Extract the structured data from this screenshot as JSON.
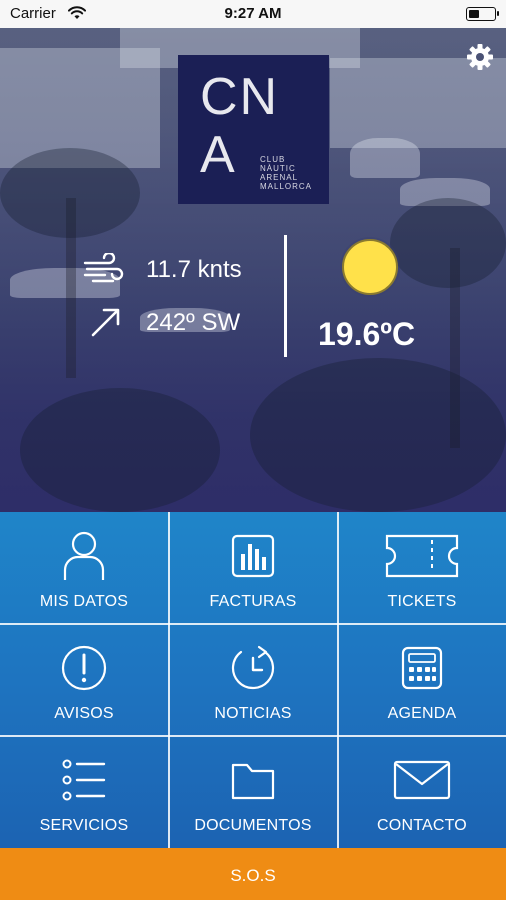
{
  "status_bar": {
    "carrier": "Carrier",
    "time": "9:27 AM"
  },
  "logo": {
    "letters_top": "CN",
    "letter_bottom": "A",
    "subtitle_lines": [
      "CLUB",
      "NÀUTIC",
      "ARENAL",
      "MALLORCA"
    ]
  },
  "weather": {
    "wind_speed": "11.7 knts",
    "wind_direction": "242º SW",
    "temperature": "19.6ºC"
  },
  "menu": [
    {
      "label": "MIS DATOS",
      "icon": "user-icon"
    },
    {
      "label": "FACTURAS",
      "icon": "bar-chart-icon"
    },
    {
      "label": "TICKETS",
      "icon": "ticket-icon"
    },
    {
      "label": "AVISOS",
      "icon": "alert-icon"
    },
    {
      "label": "NOTICIAS",
      "icon": "history-icon"
    },
    {
      "label": "AGENDA",
      "icon": "calendar-icon"
    },
    {
      "label": "SERVICIOS",
      "icon": "list-icon"
    },
    {
      "label": "DOCUMENTOS",
      "icon": "folder-icon"
    },
    {
      "label": "CONTACTO",
      "icon": "mail-icon"
    }
  ],
  "sos": {
    "label": "S.O.S"
  },
  "colors": {
    "logo_bg": "#1b1f55",
    "grid_blue": "#1e74c0",
    "sos_orange": "#ef8c14",
    "sun_yellow": "#ffe14a"
  }
}
